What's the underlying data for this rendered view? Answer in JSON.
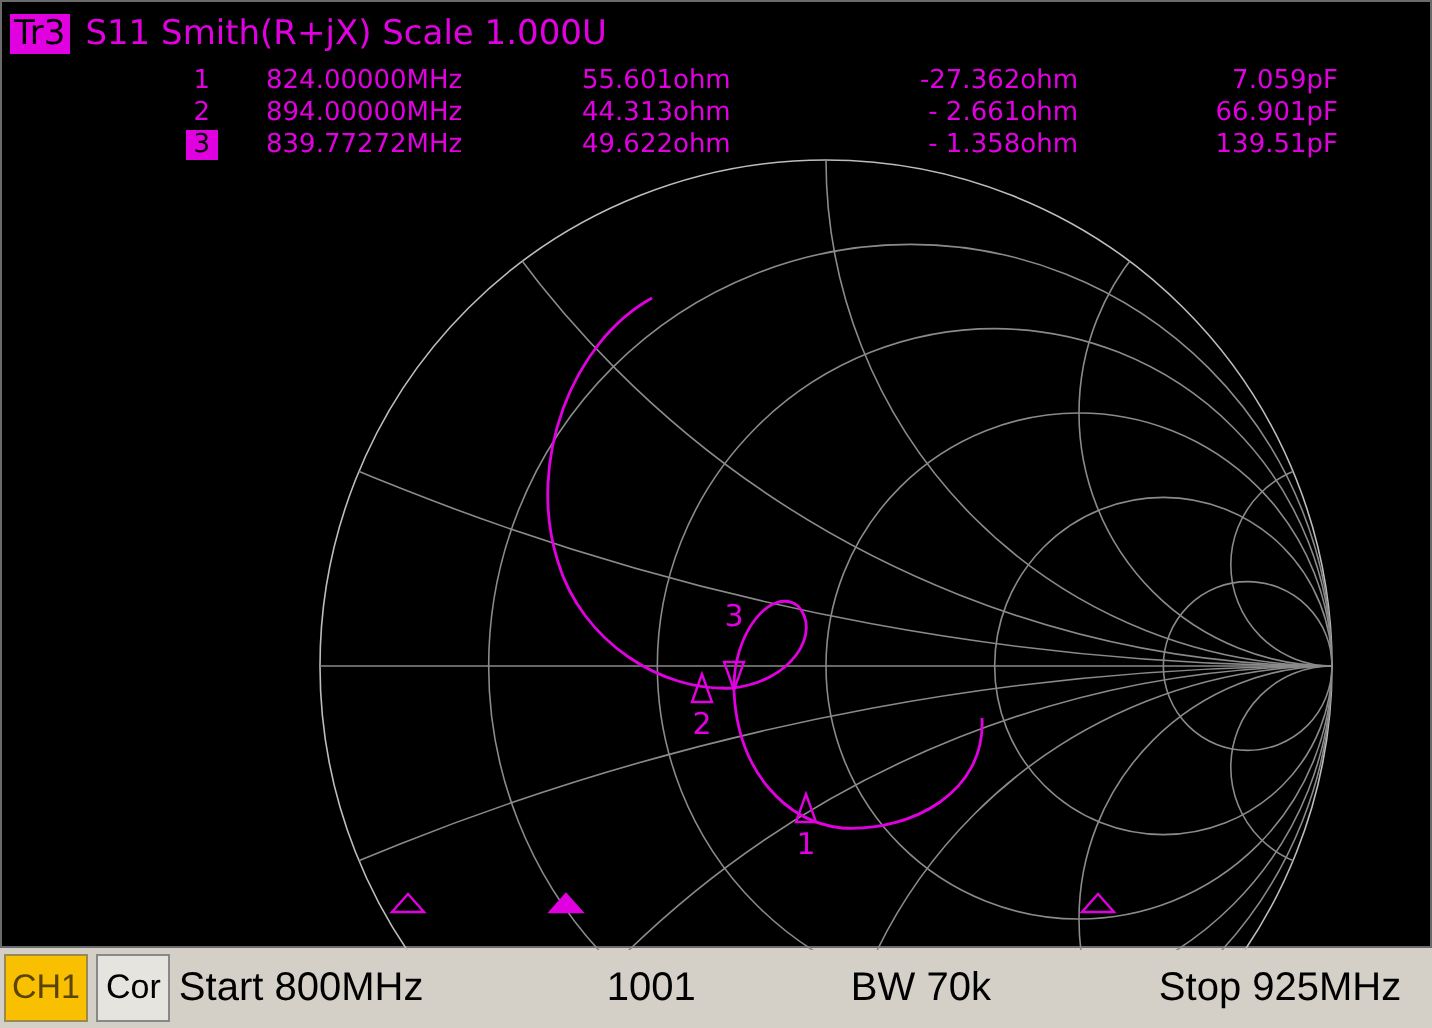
{
  "trace": {
    "badge": "Tr3",
    "title": "S11 Smith(R+jX) Scale 1.000U"
  },
  "markers": [
    {
      "number": "1",
      "frequency": "824.00000MHz",
      "resistance": "55.601ohm",
      "reactance": "-27.362ohm",
      "capacitance": "7.059pF",
      "active": false,
      "chart_label": "1"
    },
    {
      "number": "2",
      "frequency": "894.00000MHz",
      "resistance": "44.313ohm",
      "reactance": "- 2.661ohm",
      "capacitance": "66.901pF",
      "active": false,
      "chart_label": "2"
    },
    {
      "number": "3",
      "frequency": "839.77272MHz",
      "resistance": "49.622ohm",
      "reactance": "- 1.358ohm",
      "capacitance": "139.51pF",
      "active": true,
      "chart_label": "3"
    }
  ],
  "channel_bar": {
    "channel": "CH1",
    "correction": "Cor",
    "start": "Start 800MHz",
    "points": "1001",
    "bandwidth": "BW 70k",
    "stop": "Stop 925MHz"
  }
}
